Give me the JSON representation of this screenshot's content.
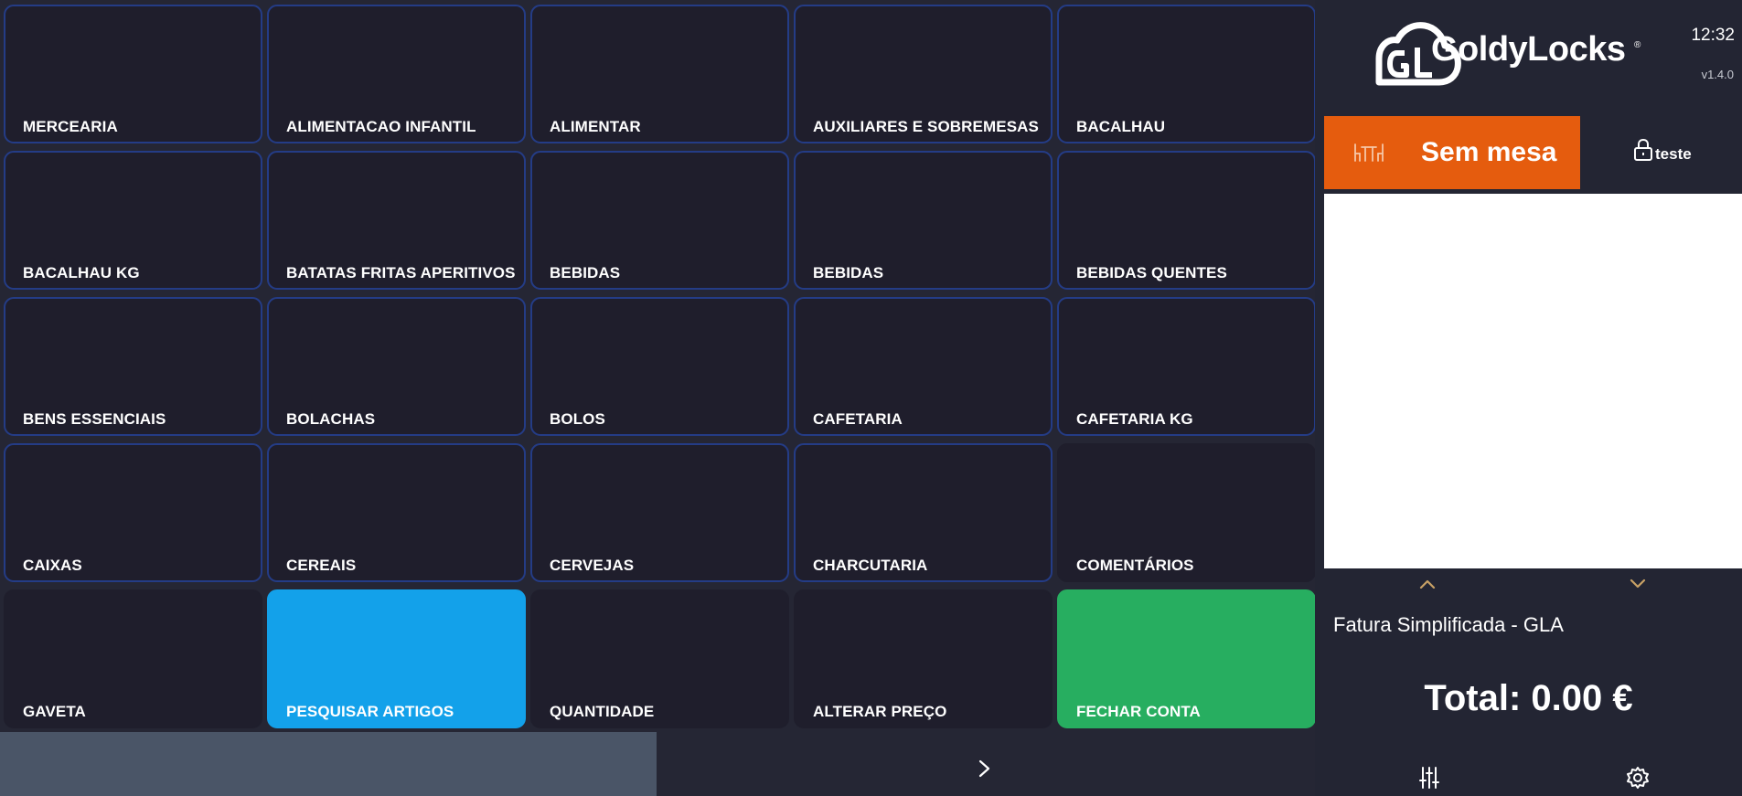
{
  "tiles": [
    {
      "label": "MERCEARIA",
      "style": "category"
    },
    {
      "label": "ALIMENTACAO INFANTIL",
      "style": "category"
    },
    {
      "label": "ALIMENTAR",
      "style": "category"
    },
    {
      "label": "AUXILIARES E SOBREMESAS",
      "style": "category"
    },
    {
      "label": "BACALHAU",
      "style": "category"
    },
    {
      "label": "BACALHAU KG",
      "style": "category"
    },
    {
      "label": "BATATAS FRITAS APERITIVOS",
      "style": "category"
    },
    {
      "label": "BEBIDAS",
      "style": "category"
    },
    {
      "label": "BEBIDAS",
      "style": "category"
    },
    {
      "label": "BEBIDAS QUENTES",
      "style": "category"
    },
    {
      "label": "BENS ESSENCIAIS",
      "style": "category"
    },
    {
      "label": "BOLACHAS",
      "style": "category"
    },
    {
      "label": "BOLOS",
      "style": "category"
    },
    {
      "label": "CAFETARIA",
      "style": "category"
    },
    {
      "label": "CAFETARIA KG",
      "style": "category"
    },
    {
      "label": "CAIXAS",
      "style": "category"
    },
    {
      "label": "CEREAIS",
      "style": "category"
    },
    {
      "label": "CERVEJAS",
      "style": "category"
    },
    {
      "label": "CHARCUTARIA",
      "style": "category"
    },
    {
      "label": "COMENTÁRIOS",
      "style": "plain"
    },
    {
      "label": "GAVETA",
      "style": "plain"
    },
    {
      "label": "PESQUISAR ARTIGOS",
      "style": "blue"
    },
    {
      "label": "QUANTIDADE",
      "style": "plain"
    },
    {
      "label": "ALTERAR PREÇO",
      "style": "plain"
    },
    {
      "label": "FECHAR CONTA",
      "style": "green"
    }
  ],
  "bottom_bar": {
    "next_icon": "chevron-right-icon"
  },
  "panel": {
    "logo_text": "GoldyLocks",
    "logo_reg": "®",
    "time": "12:32",
    "version": "v1.4.0",
    "table_button": "Sem mesa",
    "user_name": "teste",
    "document_type": "Fatura Simplificada - GLA",
    "total": "Total: 0.00 €"
  },
  "colors": {
    "background": "#252634",
    "tile": "#1f1e2c",
    "tile_border": "#243c86",
    "accent_orange": "#e55c0e",
    "search_blue": "#13a1ea",
    "close_green": "#27ae60",
    "chevron_gold": "#c8a165"
  }
}
